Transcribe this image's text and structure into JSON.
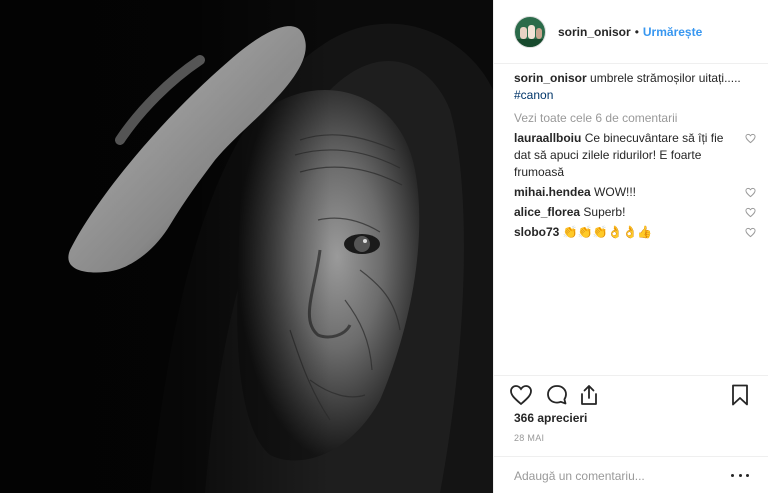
{
  "post": {
    "photo_alt": "",
    "author": "sorin_onisor",
    "follow_label": "Urmărește",
    "caption_text": "umbrele strămoșilor uitați.....",
    "caption_tag": "#canon",
    "view_all": "Vezi toate cele 6 de comentarii",
    "comments": [
      {
        "user": "lauraallboiu",
        "text": "Ce binecuvântare să îți fie dat să apuci zilele ridurilor! E foarte frumoasă"
      },
      {
        "user": "mihai.hendea",
        "text": "WOW!!!"
      },
      {
        "user": "alice_florea",
        "text": "Superb!"
      },
      {
        "user": "slobo73",
        "text": "👏👏👏👌👌👍"
      }
    ],
    "likes": "366 aprecieri",
    "date": "28 MAI",
    "add_comment_placeholder": "Adaugă un comentariu..."
  },
  "icons": {
    "like": "heart-icon",
    "comment": "comment-icon",
    "share": "share-icon",
    "save": "bookmark-icon",
    "more": "more-options-icon"
  },
  "colors": {
    "follow": "#3897f0",
    "hashtag": "#003569",
    "muted": "#999999",
    "text": "#262626"
  }
}
